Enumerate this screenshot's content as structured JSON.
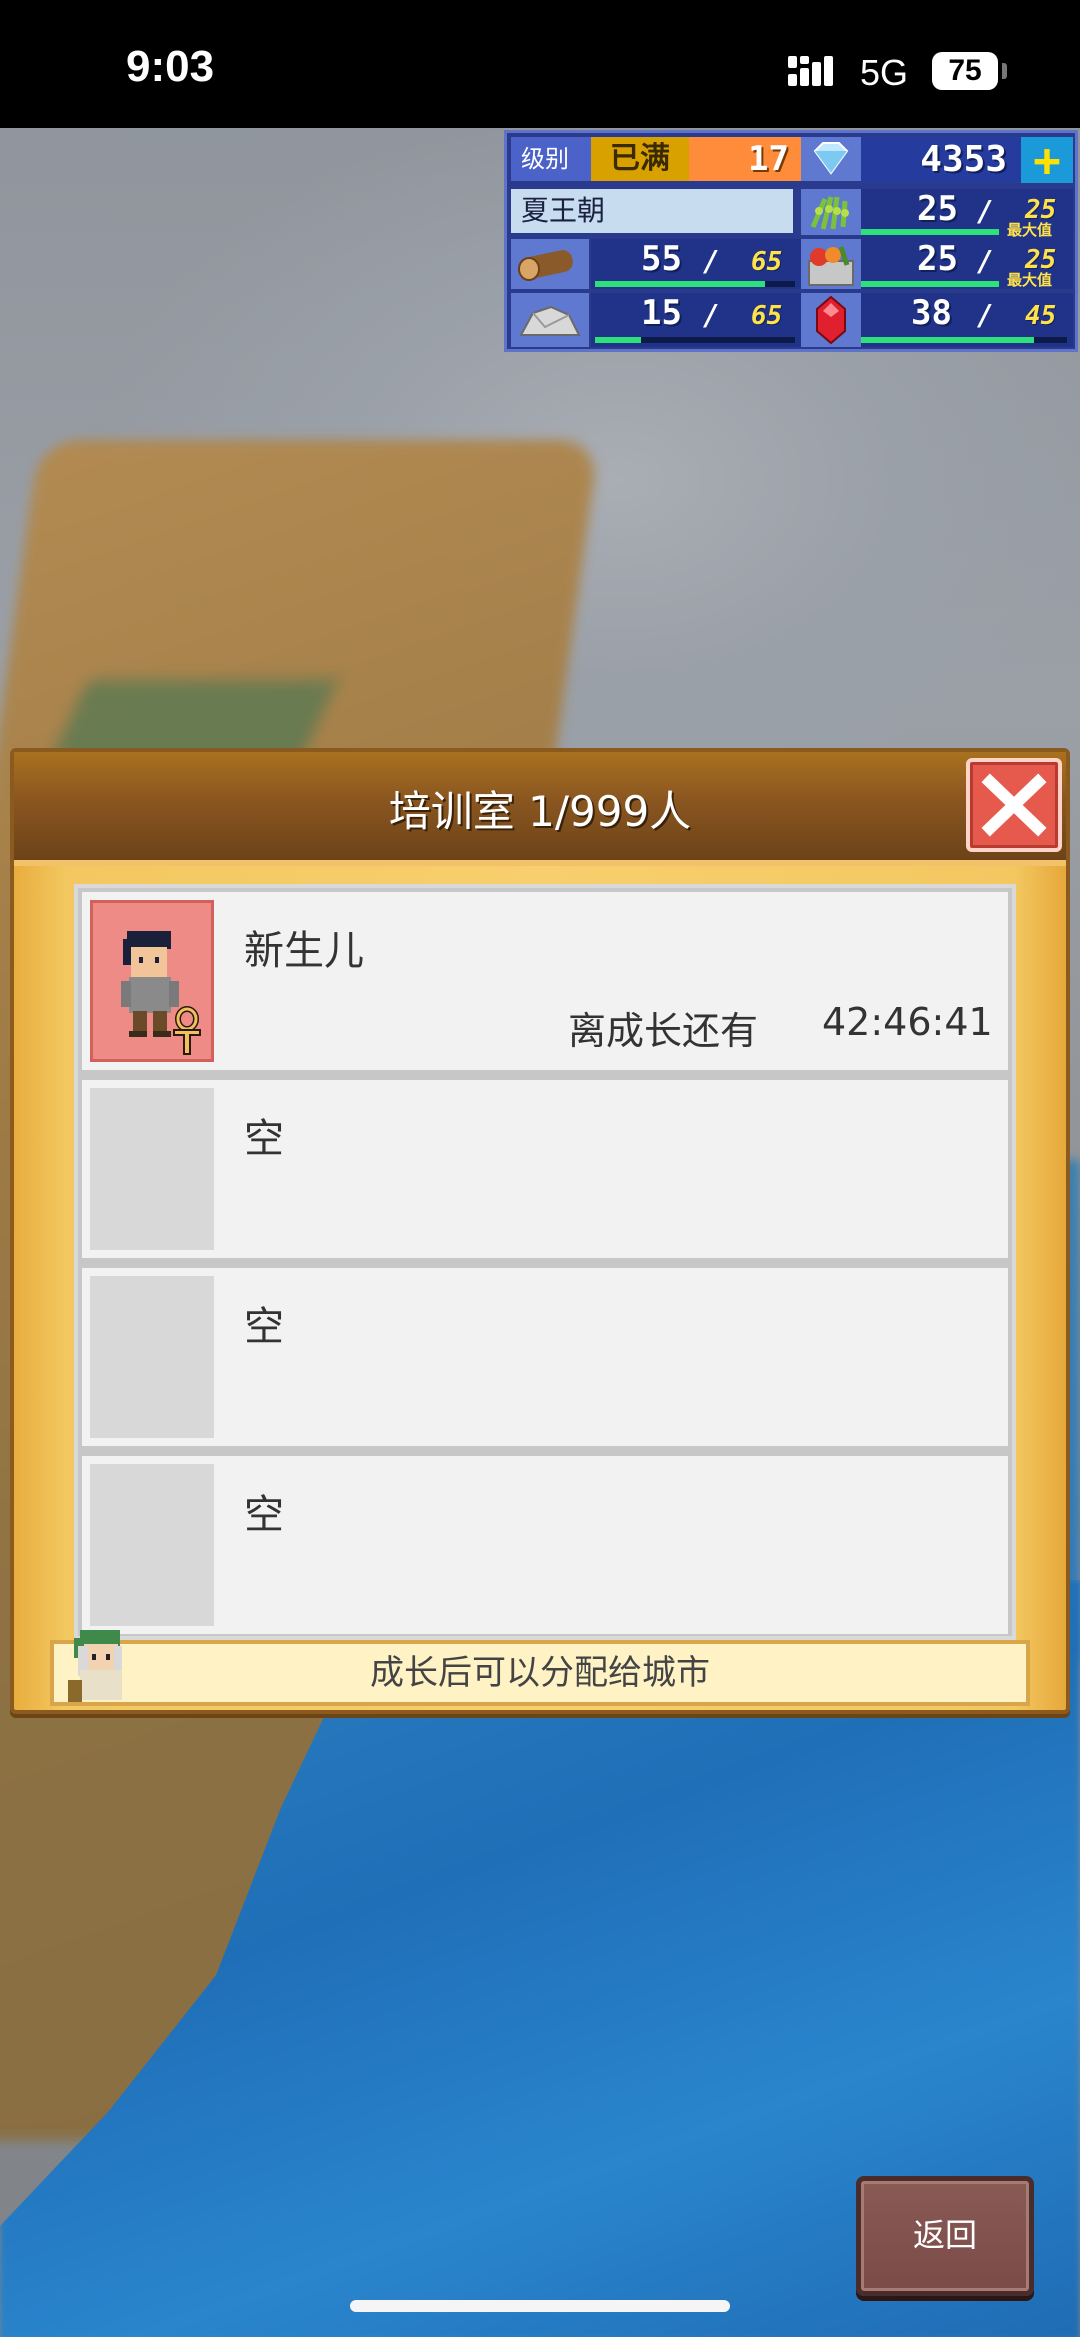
{
  "status_bar": {
    "time": "9:03",
    "network": "5G",
    "battery": "75"
  },
  "hud": {
    "level_label": "级别",
    "level_max": "已满",
    "level": "17",
    "gems": "4353",
    "plus": "+",
    "dynasty": "夏王朝",
    "resources": {
      "food": {
        "current": "25",
        "max": "25",
        "max_label": "最大值",
        "icon": "grain-icon",
        "fill": 1.0
      },
      "wood": {
        "current": "55",
        "max": "65",
        "icon": "log-icon",
        "fill": 0.85
      },
      "goods": {
        "current": "25",
        "max": "25",
        "max_label": "最大值",
        "icon": "fruit-basket-icon",
        "fill": 1.0
      },
      "stone": {
        "current": "15",
        "max": "65",
        "icon": "stone-icon",
        "fill": 0.23
      },
      "ruby": {
        "current": "38",
        "max": "45",
        "icon": "ruby-icon",
        "fill": 0.84
      }
    }
  },
  "dialog": {
    "title": "培训室 1/999人",
    "slots": [
      {
        "name": "新生儿",
        "grow_label": "离成长还有",
        "grow_time": "42:46:41",
        "filled": true
      },
      {
        "name": "空",
        "filled": false
      },
      {
        "name": "空",
        "filled": false
      },
      {
        "name": "空",
        "filled": false
      }
    ],
    "hint": "成长后可以分配给城市"
  },
  "back_button": "返回",
  "colors": {
    "dialog_gold": "#f7cf6c",
    "title_brown": "#8a5620",
    "close_red": "#e65a4e",
    "hud_blue": "#2a3a8c"
  }
}
